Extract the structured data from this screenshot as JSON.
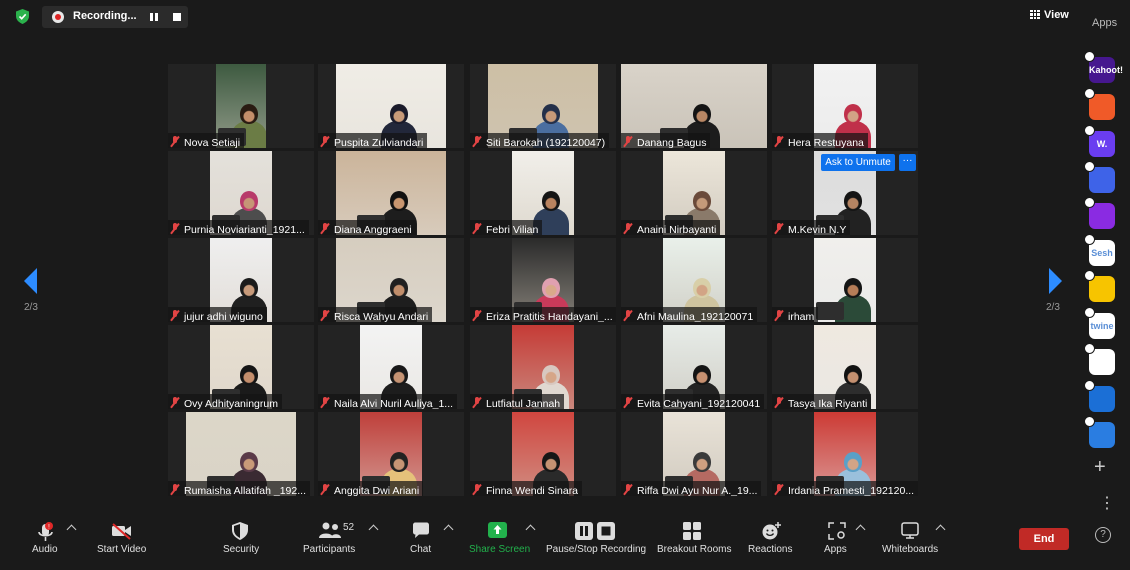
{
  "topbar": {
    "recording_label": "Recording...",
    "view_label": "View"
  },
  "pagination": {
    "left_indicator": "2/3",
    "right_indicator": "2/3"
  },
  "participants_grid": [
    {
      "name": "Nova Setiaji",
      "muted": true
    },
    {
      "name": "Puspita Zulviandari",
      "muted": true
    },
    {
      "name": "Siti Barokah (192120047)",
      "muted": true
    },
    {
      "name": "Danang Bagus",
      "muted": true
    },
    {
      "name": "Hera Restuyana",
      "muted": true
    },
    {
      "name": "Purnia Noviarianti_1921...",
      "muted": true
    },
    {
      "name": "Diana Anggraeni",
      "muted": true
    },
    {
      "name": "Febri Vilian",
      "muted": true
    },
    {
      "name": "Anaini Nirbayanti",
      "muted": true
    },
    {
      "name": "M.Kevin N.Y",
      "muted": true
    },
    {
      "name": "jujur adhi wiguno",
      "muted": true
    },
    {
      "name": "Risca Wahyu Andari",
      "muted": true
    },
    {
      "name": "Eriza Pratitis Handayani_...",
      "muted": true
    },
    {
      "name": "Afni Maulina_192120071",
      "muted": true
    },
    {
      "name": "irham",
      "muted": true
    },
    {
      "name": "Ovy Adhityaningrum",
      "muted": true
    },
    {
      "name": "Naila Alvi Nuril Auliya_1...",
      "muted": true
    },
    {
      "name": "Lutfiatul Jannah",
      "muted": true
    },
    {
      "name": "Evita Cahyani_192120041",
      "muted": true
    },
    {
      "name": "Tasya Ika Riyanti",
      "muted": true
    },
    {
      "name": "Rumaisha Allatifah _192...",
      "muted": true
    },
    {
      "name": "Anggita Dwi Ariani",
      "muted": true
    },
    {
      "name": "Finna Wendi Sinara",
      "muted": true
    },
    {
      "name": "Riffa Dwi Ayu Nur A._19...",
      "muted": true
    },
    {
      "name": "Irdania Pramesti_192120...",
      "muted": true
    }
  ],
  "hover_actions": {
    "ask_to_unmute": "Ask to Unmute",
    "more": "···"
  },
  "apps_panel": {
    "title": "Apps",
    "apps": [
      {
        "icon": "kahoot-icon",
        "label": "Kahoot!",
        "color": "#46178f"
      },
      {
        "icon": "app-orange-icon",
        "label": "",
        "color": "#f05a28"
      },
      {
        "icon": "wooclap-icon",
        "label": "W.",
        "color": "#6a3df0"
      },
      {
        "icon": "ai-app-icon",
        "label": "",
        "color": "#3e63e8"
      },
      {
        "icon": "broadcast-app-icon",
        "label": "",
        "color": "#8a2be2"
      },
      {
        "icon": "sesh-icon",
        "label": "Sesh",
        "color": "#ffffff"
      },
      {
        "icon": "emoji-app-icon",
        "label": "",
        "color": "#f7c400"
      },
      {
        "icon": "twine-icon",
        "label": "twine",
        "color": "#ffffff"
      },
      {
        "icon": "tiles-app-icon",
        "label": "",
        "color": "#ffffff"
      },
      {
        "icon": "sync-app-icon",
        "label": "",
        "color": "#1b6fd6"
      },
      {
        "icon": "e-app-icon",
        "label": "",
        "color": "#2a7de1"
      }
    ],
    "add_label": "+",
    "more_label": "⋮",
    "help_label": "?"
  },
  "toolbar": {
    "audio": "Audio",
    "start_video": "Start Video",
    "security": "Security",
    "participants": "Participants",
    "participants_count": "52",
    "chat": "Chat",
    "share_screen": "Share Screen",
    "pause_stop_recording": "Pause/Stop Recording",
    "breakout_rooms": "Breakout Rooms",
    "reactions": "Reactions",
    "apps": "Apps",
    "whiteboards": "Whiteboards",
    "end": "End"
  },
  "colors": {
    "accent": "#2d8cff",
    "share_green": "#22b14c",
    "end_red": "#c12a26",
    "muted_red": "#e24444",
    "background": "#1a1a1a"
  }
}
